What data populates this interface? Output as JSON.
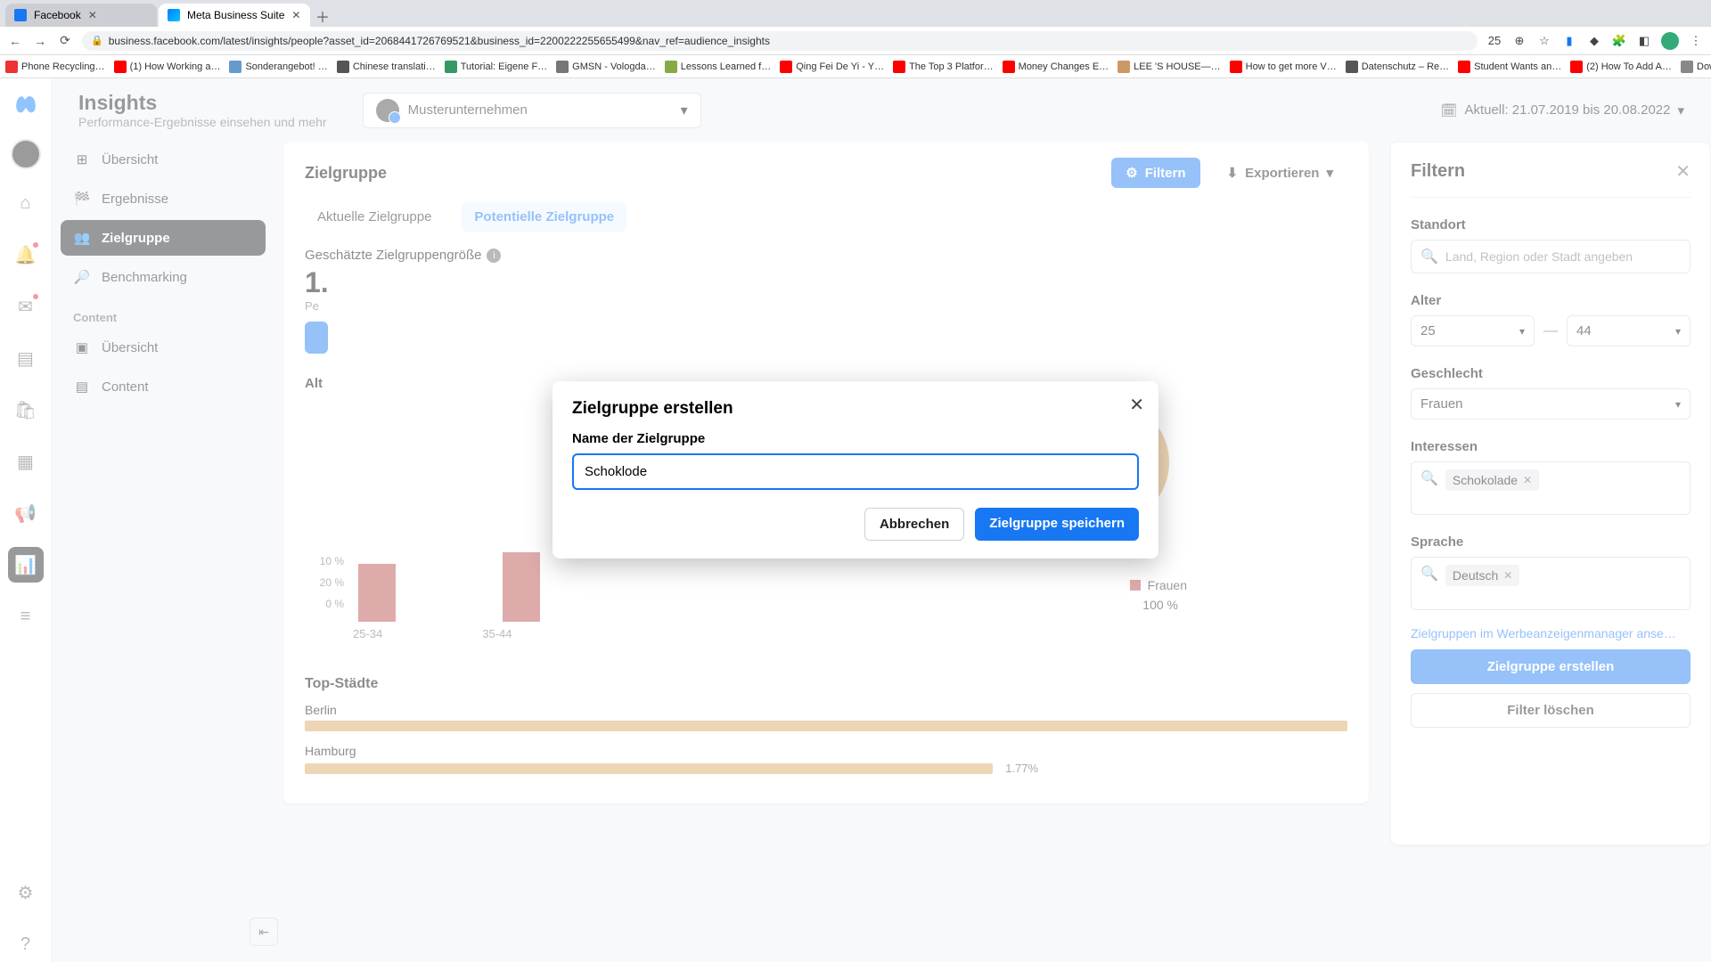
{
  "browser": {
    "tabs": [
      {
        "title": "Facebook",
        "favicon_color": "#1877f2"
      },
      {
        "title": "Meta Business Suite",
        "favicon_color": "#0a7cff"
      }
    ],
    "url": "business.facebook.com/latest/insights/people?asset_id=2068441726769521&business_id=2200222255655499&nav_ref=audience_insights",
    "addr_icon_count": "25",
    "bookmarks": [
      "Phone Recycling…",
      "(1) How Working a…",
      "Sonderangebot! …",
      "Chinese translati…",
      "Tutorial: Eigene F…",
      "GMSN - Vologda…",
      "Lessons Learned f…",
      "Qing Fei De Yi - Y…",
      "The Top 3 Platfor…",
      "Money Changes E…",
      "LEE 'S HOUSE—…",
      "How to get more V…",
      "Datenschutz – Re…",
      "Student Wants an…",
      "(2) How To Add A…",
      "Download - Cooki…"
    ]
  },
  "header": {
    "title": "Insights",
    "subtitle": "Performance-Ergebnisse einsehen und mehr",
    "page_name": "Musterunternehmen",
    "date_label": "Aktuell: 21.07.2019 bis 20.08.2022"
  },
  "subnav": {
    "items": [
      "Übersicht",
      "Ergebnisse",
      "Zielgruppe",
      "Benchmarking"
    ],
    "heading": "Content",
    "content_items": [
      "Übersicht",
      "Content"
    ]
  },
  "card": {
    "title": "Zielgruppe",
    "filter_btn": "Filtern",
    "export_btn": "Exportieren",
    "tab_current": "Aktuelle Zielgruppe",
    "tab_potential": "Potentielle Zielgruppe",
    "size_label": "Geschätzte Zielgruppengröße",
    "size_value": "1.",
    "size_sub": "Pe",
    "age_heading": "Alt",
    "ylabels": [
      "10 %",
      "20 %",
      "0 %"
    ],
    "xlabels": [
      "25-34",
      "35-44"
    ],
    "legend_series": "Frauen",
    "legend_pct": "100 %",
    "cities_heading": "Top-Städte",
    "cities": [
      {
        "name": "Berlin",
        "pct": "",
        "width": 100
      },
      {
        "name": "Hamburg",
        "pct": "1.77%",
        "width": 66
      }
    ]
  },
  "chart_data": {
    "type": "bar",
    "categories": [
      "25-34",
      "35-44"
    ],
    "series": [
      {
        "name": "Frauen",
        "values": [
          40,
          48
        ]
      }
    ],
    "ylim": [
      0,
      50
    ],
    "ylabel": "%",
    "donut": {
      "series": "Frauen",
      "value_pct": 100
    }
  },
  "filter": {
    "title": "Filtern",
    "loc_label": "Standort",
    "loc_placeholder": "Land, Region oder Stadt angeben",
    "age_label": "Alter",
    "age_from": "25",
    "age_to": "44",
    "gender_label": "Geschlecht",
    "gender_value": "Frauen",
    "interest_label": "Interessen",
    "interest_chip": "Schokolade",
    "lang_label": "Sprache",
    "lang_chip": "Deutsch",
    "link": "Zielgruppen im Werbeanzeigenmanager anse…",
    "create_btn": "Zielgruppe erstellen",
    "clear_btn": "Filter löschen"
  },
  "modal": {
    "title": "Zielgruppe erstellen",
    "label": "Name der Zielgruppe",
    "value": "Schoklode",
    "cancel": "Abbrechen",
    "save": "Zielgruppe speichern"
  }
}
